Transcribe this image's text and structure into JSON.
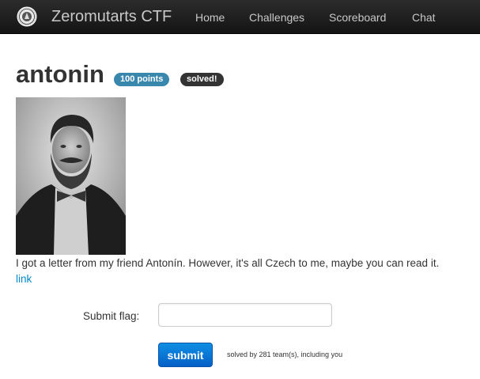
{
  "navbar": {
    "brand": "Zeromutarts CTF",
    "items": [
      {
        "label": "Home"
      },
      {
        "label": "Challenges"
      },
      {
        "label": "Scoreboard"
      },
      {
        "label": "Chat"
      }
    ]
  },
  "challenge": {
    "title": "antonin",
    "points_badge": "100 points",
    "status_badge": "solved!",
    "description": "I got a letter from my friend Antonín. However, it's all Czech to me, maybe you can read it.",
    "link_label": "link"
  },
  "form": {
    "flag_label": "Submit flag:",
    "flag_value": "",
    "submit_label": "submit",
    "solved_info": "solved by 281 team(s), including you"
  },
  "colors": {
    "navbar": "#1b1b1b",
    "points_badge": "#3a87ad",
    "solved_badge": "#333333",
    "link": "#0088cc",
    "submit_button": "#0a6fd6"
  }
}
